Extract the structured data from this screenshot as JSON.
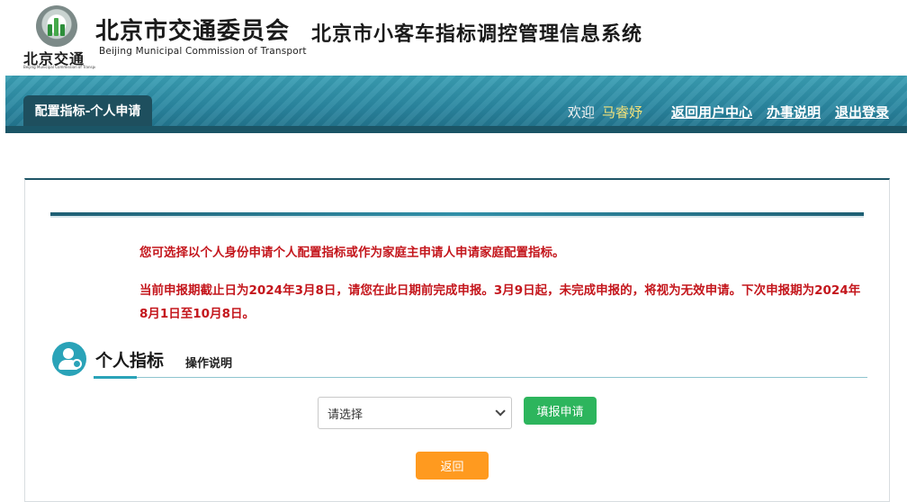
{
  "header": {
    "logo_text": "北京交通",
    "logo_subtext": "Beijing Municipal Commission of Transport",
    "agency_name": "北京市交通委员会",
    "agency_name_en": "Beijing Municipal Commission of Transport",
    "system_title": "北京市小客车指标调控管理信息系统"
  },
  "nav": {
    "page_tab": "配置指标-个人申请",
    "welcome": "欢迎",
    "username": "马睿妤",
    "links": [
      "返回用户中心",
      "办事说明",
      "退出登录"
    ]
  },
  "notices": [
    "您可选择以个人身份申请个人配置指标或作为家庭主申请人申请家庭配置指标。",
    "当前申报期截止日为2024年3月8日，请您在此日期前完成申报。3月9日起，未完成申报的，将视为无效申请。下次申报期为2024年8月1日至10月8日。"
  ],
  "section": {
    "title": "个人指标",
    "help_link": "操作说明",
    "select_value": "请选择",
    "submit_label": "填报申请",
    "back_label": "返回"
  },
  "colors": {
    "banner": "#2a86a0",
    "tab_dark": "#1e4f5e",
    "notice_red": "#c4161c",
    "username_yellow": "#f3e27a",
    "submit_green": "#2db55d",
    "back_orange": "#ff9a1f",
    "icon_teal": "#2aa3b8"
  },
  "icons": {
    "logo": "transport-commission-logo",
    "section": "user-avatar-icon",
    "select": "chevron-down-icon"
  }
}
